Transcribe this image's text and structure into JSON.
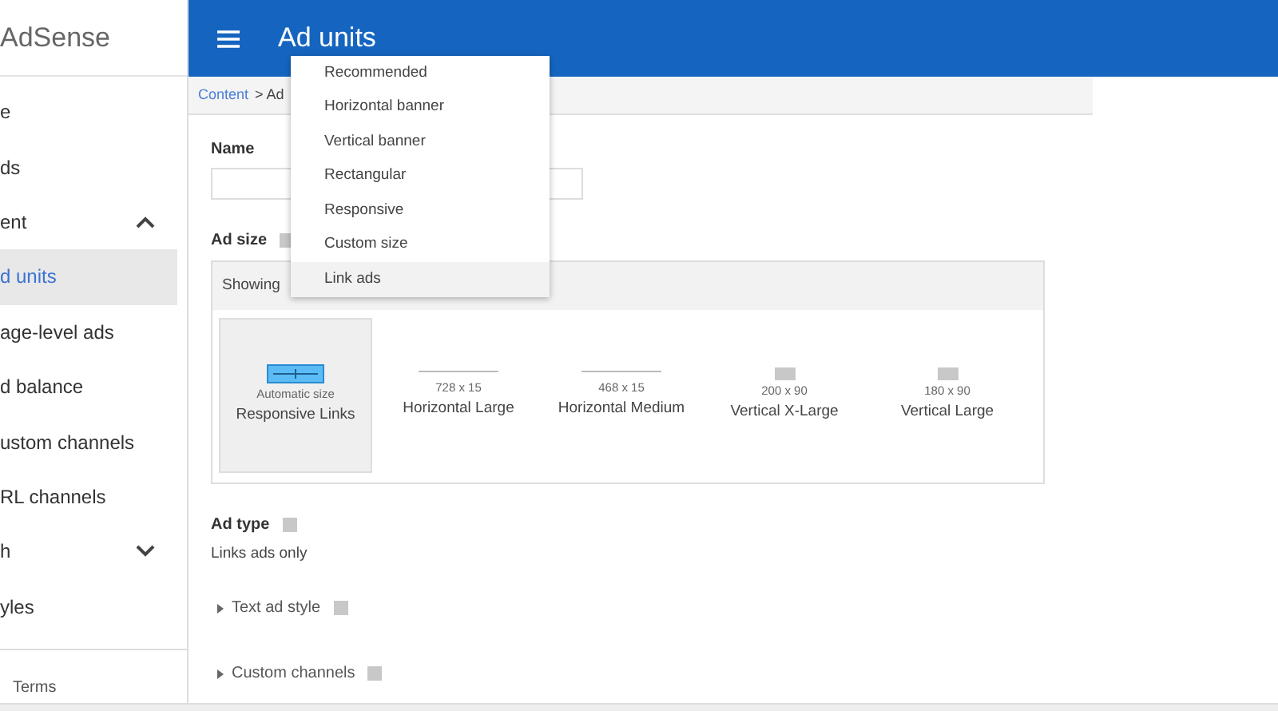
{
  "sidebar": {
    "brand": "AdSense",
    "items": [
      {
        "label": "e",
        "selected": false
      },
      {
        "label": "ds",
        "selected": false
      },
      {
        "label": "ent",
        "selected": false,
        "expanded": true
      },
      {
        "label": "d units",
        "selected": true
      },
      {
        "label": "age-level ads",
        "selected": false
      },
      {
        "label": "d balance",
        "selected": false
      },
      {
        "label": "ustom channels",
        "selected": false
      },
      {
        "label": "RL channels",
        "selected": false
      },
      {
        "label": "h",
        "selected": false,
        "expanded": false
      },
      {
        "label": "yles",
        "selected": false
      }
    ],
    "footer_link": "Terms"
  },
  "header": {
    "title": "Ad units"
  },
  "breadcrumb": {
    "link": "Content",
    "current": "> Ad"
  },
  "dropdown": [
    {
      "label": "Recommended",
      "selected": false
    },
    {
      "label": "Horizontal banner",
      "selected": false
    },
    {
      "label": "Vertical banner",
      "selected": false
    },
    {
      "label": "Rectangular",
      "selected": false
    },
    {
      "label": "Responsive",
      "selected": false
    },
    {
      "label": "Custom size",
      "selected": false
    },
    {
      "label": "Link ads",
      "selected": true
    }
  ],
  "form": {
    "name_label": "Name",
    "ad_size_label": "Ad size",
    "showing_label": "Showing",
    "sizes": [
      {
        "kind": "responsive",
        "size": "Automatic size",
        "label": "Responsive Links",
        "selected": true
      },
      {
        "kind": "horizontal",
        "size": "728 x 15",
        "label": "Horizontal Large",
        "selected": false
      },
      {
        "kind": "horizontal",
        "size": "468 x 15",
        "label": "Horizontal Medium",
        "selected": false
      },
      {
        "kind": "vertical",
        "size": "200 x 90",
        "label": "Vertical X-Large",
        "selected": false
      },
      {
        "kind": "vertical",
        "size": "180 x 90",
        "label": "Vertical Large",
        "selected": false
      }
    ],
    "ad_type_label": "Ad type",
    "ad_type_value": "Links ads only",
    "sections": [
      "Text ad style",
      "Custom channels"
    ]
  }
}
